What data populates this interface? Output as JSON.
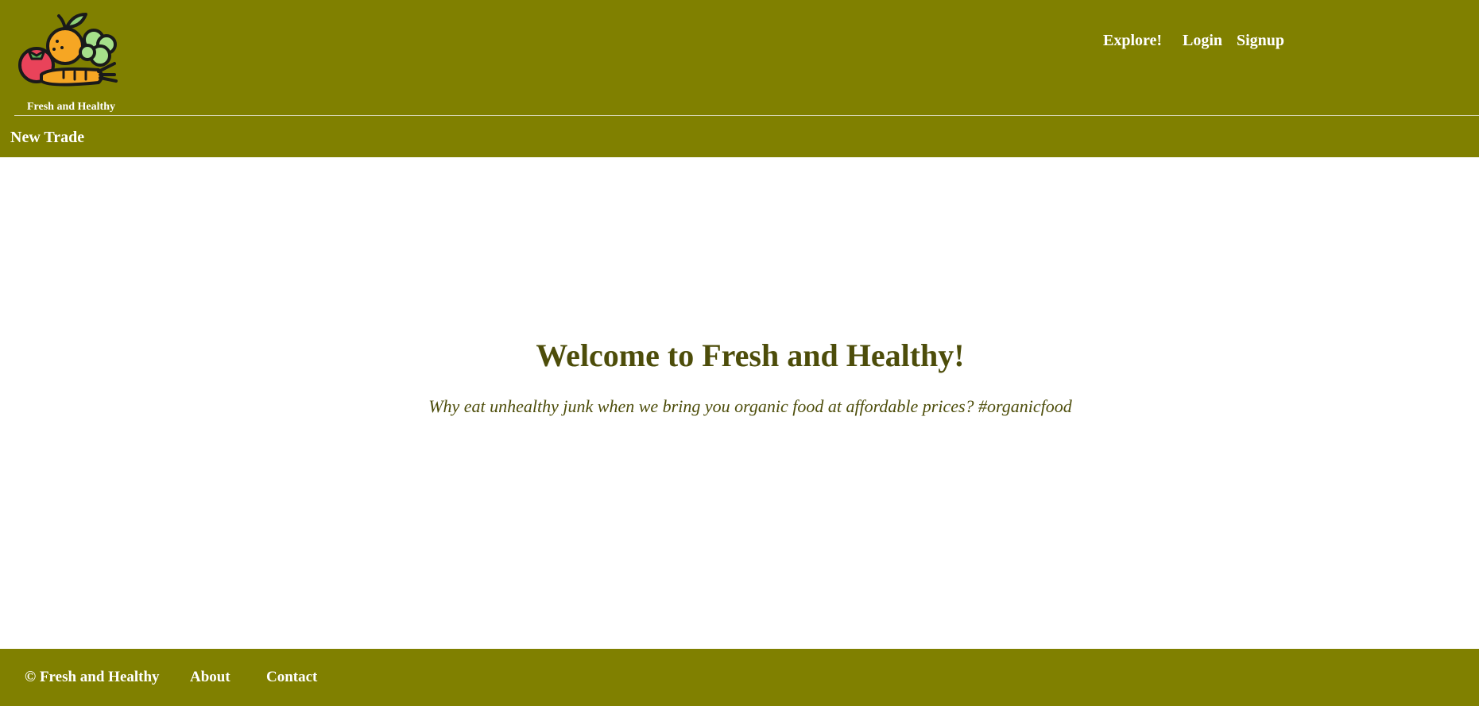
{
  "header": {
    "logo_icon": "fruit-vegetable-basket-icon",
    "brand_caption": "Fresh and Healthy",
    "nav": {
      "explore": "Explore!",
      "login": "Login",
      "signup": "Signup"
    },
    "sub_nav": {
      "new_trade": "New Trade"
    }
  },
  "hero": {
    "title": "Welcome to Fresh and Healthy!",
    "subtitle": "Why eat unhealthy junk when we bring you organic food at affordable prices? #organicfood"
  },
  "footer": {
    "copyright": "© Fresh and Healthy",
    "about": "About",
    "contact": "Contact"
  },
  "colors": {
    "brand_olive": "#808000",
    "heading_text": "#4d4d0a",
    "nav_text": "#ffffff"
  }
}
